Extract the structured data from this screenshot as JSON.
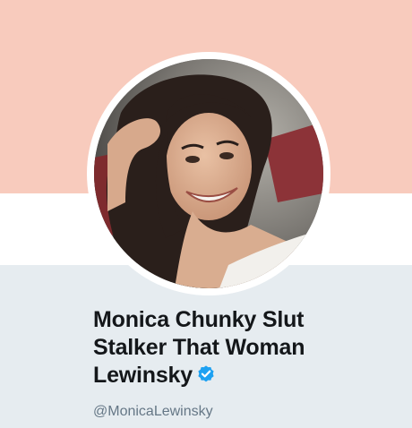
{
  "profile": {
    "name_lines": [
      "Monica Chunky Slut",
      "Stalker That Woman",
      "Lewinsky"
    ],
    "handle": "@MonicaLewinsky",
    "verified": true,
    "verified_icon": "verified-badge-icon"
  },
  "colors": {
    "banner": "#f8cbbd",
    "band": "#ffffff",
    "lower_background": "#e6ecf0",
    "name_text": "#14171a",
    "handle_text": "#657786",
    "verified_badge": "#1da1f2"
  }
}
